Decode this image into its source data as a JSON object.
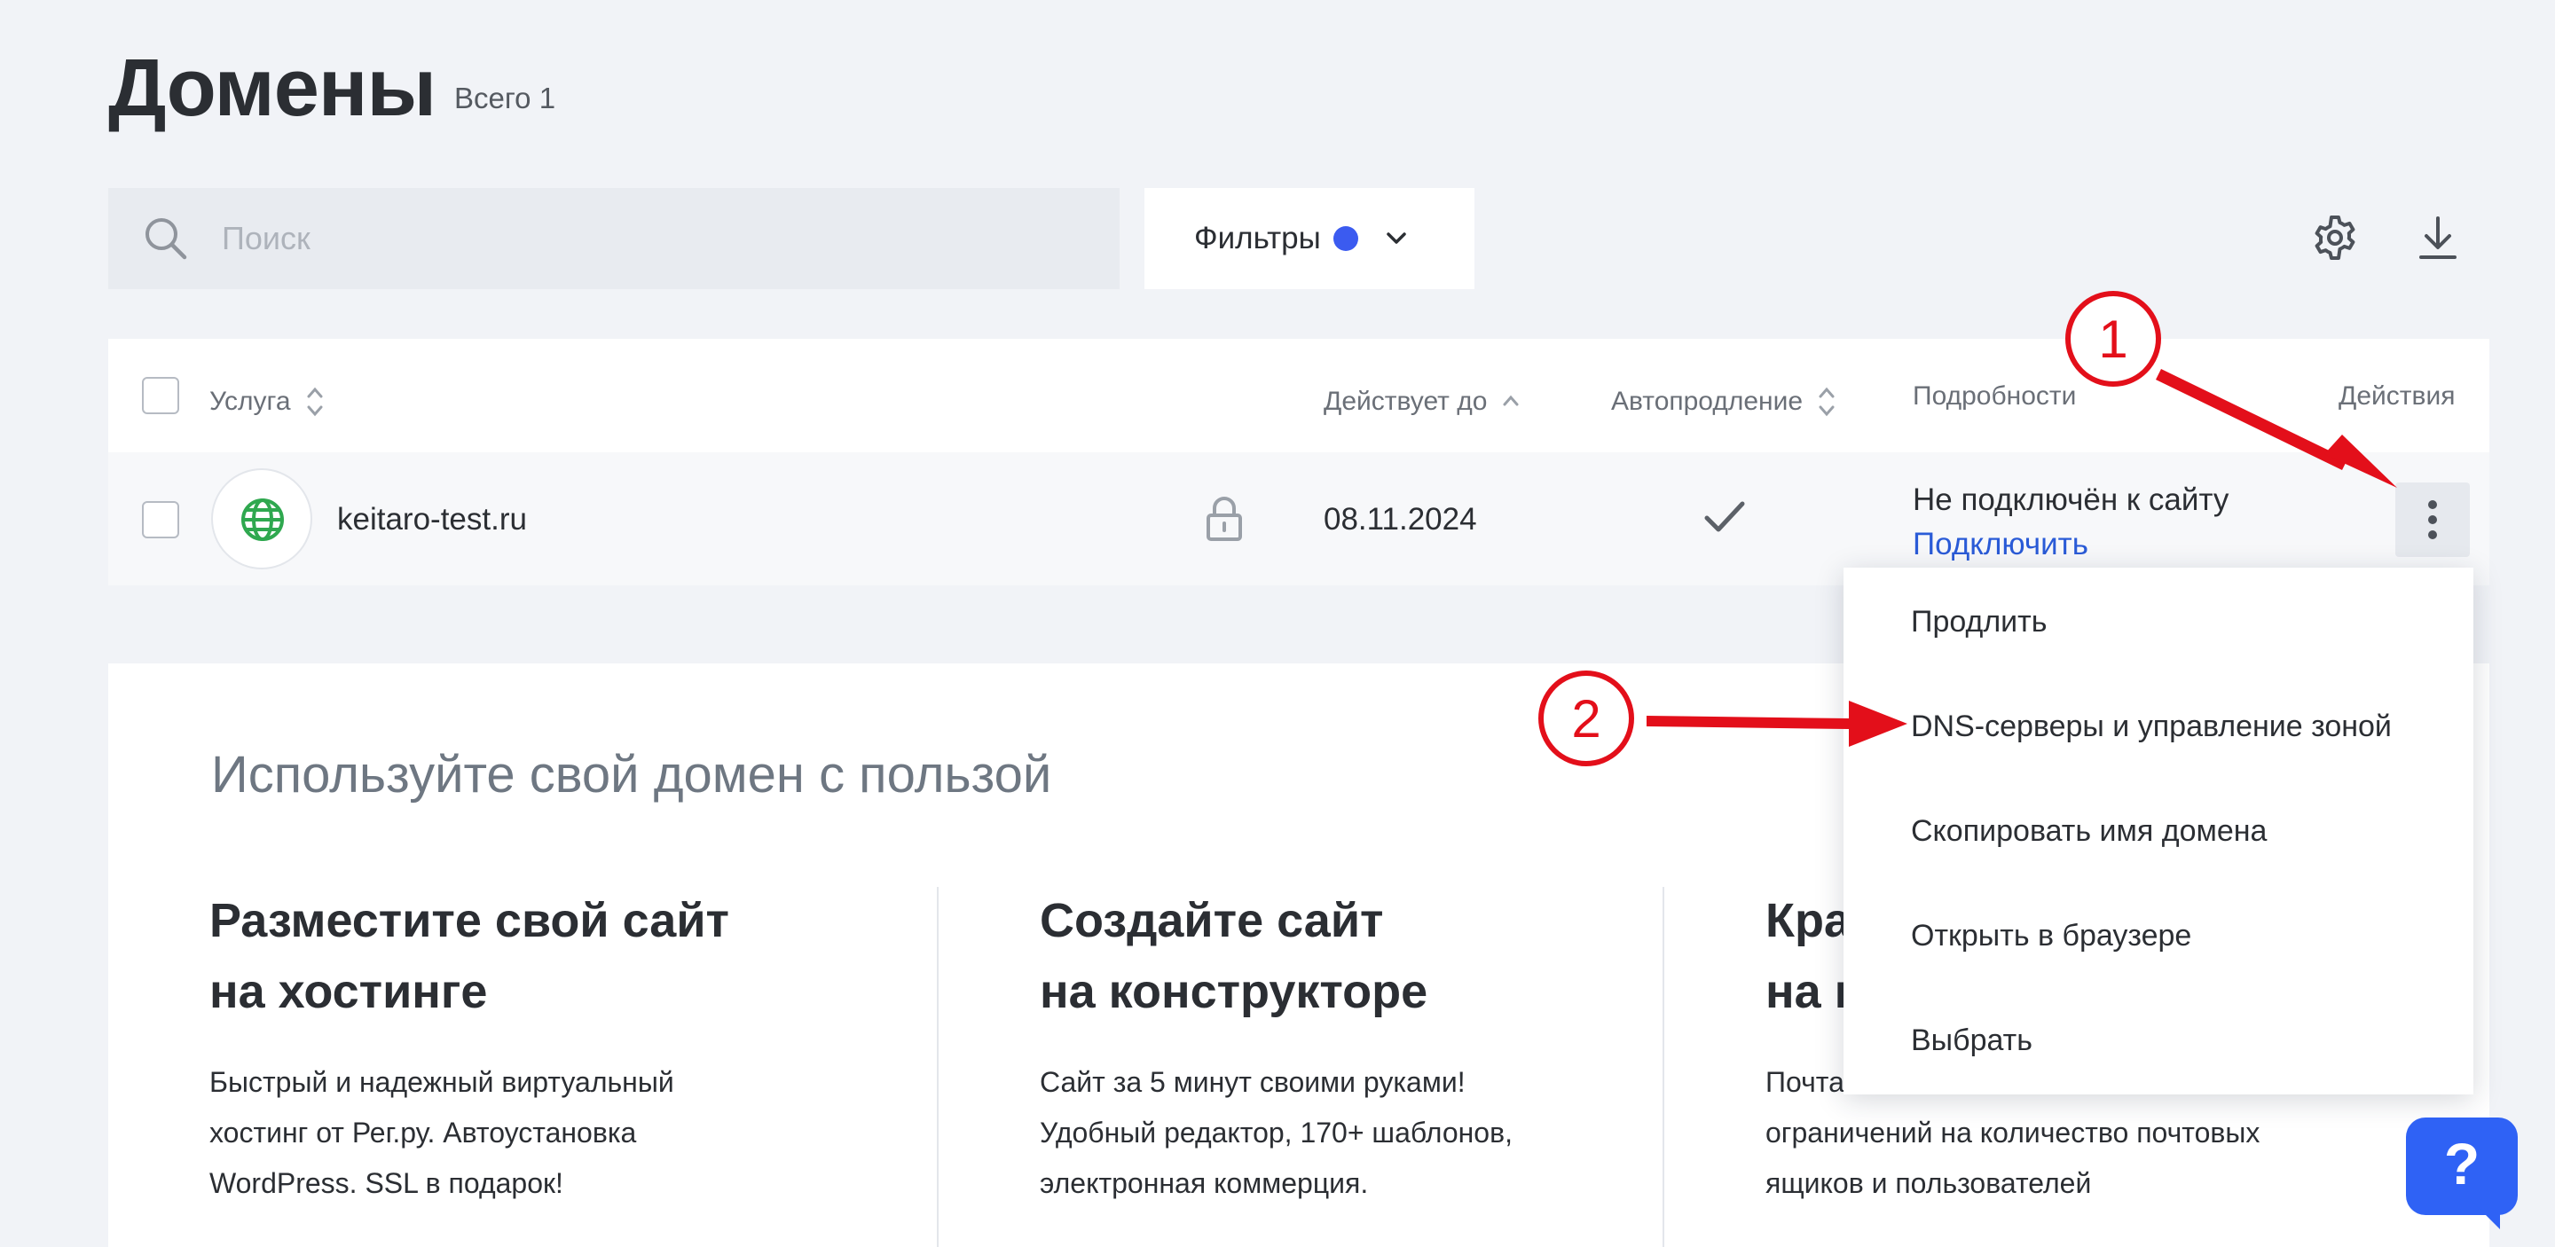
{
  "page": {
    "title": "Домены",
    "total": "Всего 1"
  },
  "toolbar": {
    "search_placeholder": "Поиск",
    "search_value": "",
    "filters_label": "Фильтры",
    "filters_dot_color": "#3b5bf0",
    "settings_icon": "gear-icon",
    "download_icon": "download-icon"
  },
  "table": {
    "headers": {
      "service": "Услуга",
      "valid_until": "Действует до",
      "autorenew": "Автопродление",
      "details": "Подробности",
      "actions": "Действия"
    },
    "rows": [
      {
        "domain": "keitaro-test.ru",
        "expires": "08.11.2024",
        "autorenew": true,
        "status": "Не подключён к сайту",
        "connect_link": "Подключить"
      }
    ]
  },
  "actions_menu": {
    "items": [
      "Продлить",
      "DNS-серверы и управление зоной",
      "Скопировать имя домена",
      "Открыть в браузере",
      "Выбрать"
    ]
  },
  "promo": {
    "title": "Используйте свой домен с пользой",
    "columns": [
      {
        "heading_line1": "Разместите свой сайт",
        "heading_line2": "на хостинге",
        "text_line1": "Быстрый и надежный виртуальный",
        "text_line2": "хостинг от Рег.ру. Автоустановка",
        "text_line3": "WordPress. SSL в подарок!"
      },
      {
        "heading_line1": "Создайте сайт",
        "heading_line2": "на конструкторе",
        "text_line1": "Сайт за 5 минут своими руками!",
        "text_line2": "Удобный редактор, 170+ шаблонов,",
        "text_line3": "электронная коммерция."
      },
      {
        "heading_line1": "Кра",
        "heading_line2": "на п",
        "text_line1": "Почта",
        "text_line2": "ограничений на количество почтовых",
        "text_line3": "ящиков и пользователей"
      }
    ]
  },
  "help": {
    "label": "?"
  },
  "annotations": {
    "step1": "1",
    "step2": "2",
    "color": "#e30f1a"
  },
  "colors": {
    "accent_blue": "#2f62f5",
    "link_blue": "#2a5bd7",
    "globe_green": "#2fa84f"
  }
}
